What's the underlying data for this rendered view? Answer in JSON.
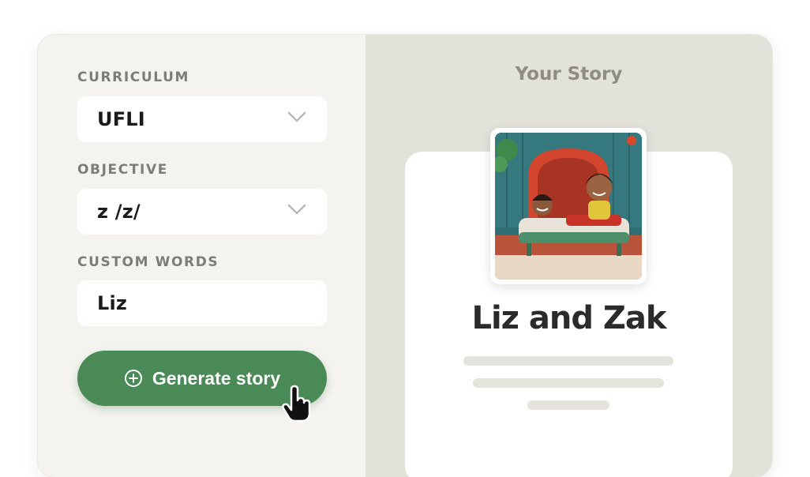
{
  "form": {
    "curriculum": {
      "label": "CURRICULUM",
      "value": "UFLI",
      "icon": "chevron-down-icon"
    },
    "objective": {
      "label": "OBJECTIVE",
      "value": "z /z/",
      "icon": "chevron-down-icon"
    },
    "custom_words": {
      "label": "CUSTOM WORDS",
      "value": "Liz"
    },
    "generate_button": {
      "label": "Generate story",
      "icon": "plus-circle-icon",
      "color": "#4a8a56"
    }
  },
  "story": {
    "header": "Your Story",
    "image": "story-illustration",
    "title": "Liz and Zak"
  },
  "colors": {
    "left_panel": "#f4f3ef",
    "right_panel": "#e3e2da",
    "accent_green": "#4a8a56"
  }
}
